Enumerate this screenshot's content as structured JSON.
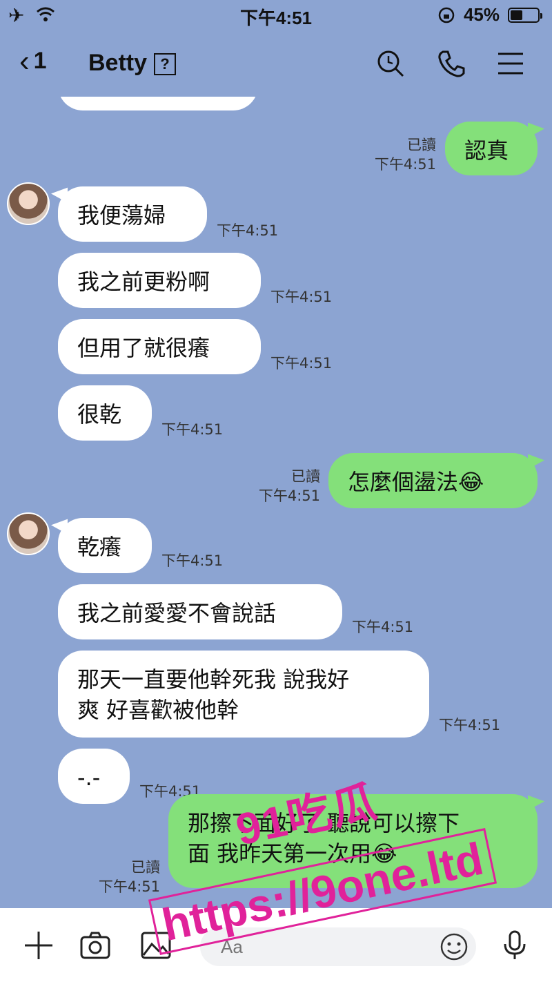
{
  "status_bar": {
    "time": "下午4:51",
    "battery": "45%",
    "battery_level": 0.45
  },
  "header": {
    "back_count": "1",
    "contact_name": "Betty",
    "unknown_badge": "?"
  },
  "messages": [
    {
      "side": "in",
      "text": "我便蕩婦",
      "time": "下午4:51"
    },
    {
      "side": "out",
      "text": "認真",
      "read": "已讀",
      "time": "下午4:51"
    },
    {
      "side": "in",
      "text": "我之前更粉啊",
      "time": "下午4:51"
    },
    {
      "side": "in",
      "text": "但用了就很癢",
      "time": "下午4:51"
    },
    {
      "side": "in",
      "text": "很乾",
      "time": "下午4:51"
    },
    {
      "side": "out",
      "text": "怎麼個盪法😂",
      "read": "已讀",
      "time": "下午4:51"
    },
    {
      "side": "in",
      "text": "乾癢",
      "time": "下午4:51"
    },
    {
      "side": "in",
      "text": "我之前愛愛不會說話",
      "time": "下午4:51"
    },
    {
      "side": "in",
      "text": "那天一直要他幹死我 說我好\n爽 好喜歡被他幹",
      "time": "下午4:51"
    },
    {
      "side": "in",
      "text": "-.-",
      "time": "下午4:51"
    },
    {
      "side": "out",
      "text": "那擦下面好了 聽說可以擦下\n面 我昨天第一次用😂",
      "read": "已讀",
      "time": "下午4:51"
    }
  ],
  "input": {
    "placeholder": "Aa"
  },
  "watermark": {
    "line1": "91吃瓜",
    "line2": "https://9one.ltd"
  },
  "colors": {
    "background": "#8ca4d2",
    "outgoing_bubble": "#84e07a",
    "incoming_bubble": "#ffffff",
    "watermark": "#e0229a"
  }
}
